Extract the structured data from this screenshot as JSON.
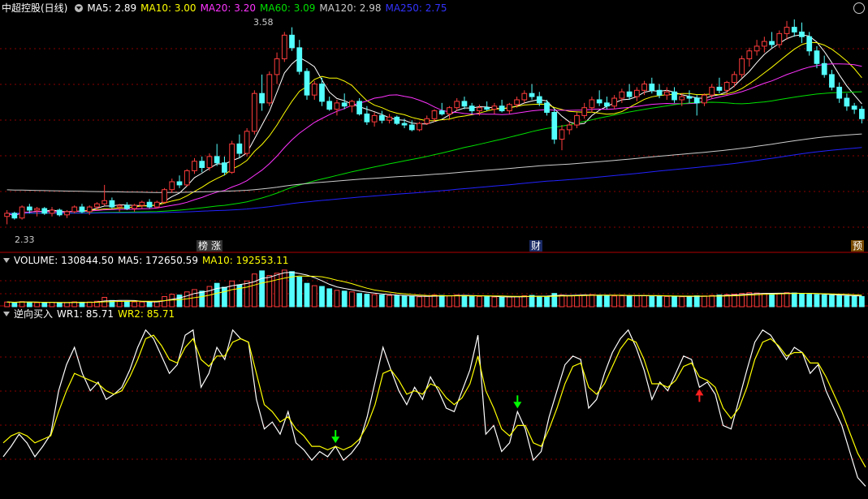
{
  "price_panel": {
    "title": "中超控股(日线)",
    "ma5": "MA5: 2.89",
    "ma10": "MA10: 3.00",
    "ma20": "MA20: 3.20",
    "ma60": "MA60: 3.09",
    "ma120": "MA120: 2.98",
    "ma250": "MA250: 2.75",
    "high_label": "3.58",
    "low_label": "2.33",
    "events": [
      "榜",
      "涨",
      "财",
      "预"
    ]
  },
  "volume_panel": {
    "vol": "VOLUME: 130844.50",
    "ma5": "MA5: 172650.59",
    "ma10": "MA10: 192553.11"
  },
  "indicator_panel": {
    "name": "逆向买入",
    "wr1": "WR1: 85.71",
    "wr2": "WR2: 85.71"
  },
  "colors": {
    "up": "#ff3c3c",
    "down": "#54ffff",
    "ma5": "#ffffff",
    "ma10": "#ffff00",
    "ma20": "#ff33ff",
    "ma60": "#00e000",
    "ma120": "#cccccc",
    "ma250": "#2222ff",
    "grid": "#8b0000"
  },
  "chart_data": {
    "type": "candlestick",
    "title": "中超控股(日线)",
    "price_range": [
      2.25,
      3.65
    ],
    "candles": [
      [
        2.38,
        2.42,
        2.33,
        2.4
      ],
      [
        2.4,
        2.41,
        2.36,
        2.37
      ],
      [
        2.37,
        2.45,
        2.36,
        2.44
      ],
      [
        2.44,
        2.46,
        2.4,
        2.42
      ],
      [
        2.42,
        2.44,
        2.38,
        2.43
      ],
      [
        2.43,
        2.44,
        2.39,
        2.4
      ],
      [
        2.4,
        2.44,
        2.38,
        2.42
      ],
      [
        2.42,
        2.43,
        2.38,
        2.39
      ],
      [
        2.39,
        2.42,
        2.37,
        2.41
      ],
      [
        2.41,
        2.45,
        2.4,
        2.44
      ],
      [
        2.44,
        2.46,
        2.4,
        2.41
      ],
      [
        2.41,
        2.45,
        2.39,
        2.44
      ],
      [
        2.44,
        2.47,
        2.42,
        2.46
      ],
      [
        2.46,
        2.58,
        2.45,
        2.48
      ],
      [
        2.48,
        2.5,
        2.43,
        2.44
      ],
      [
        2.44,
        2.46,
        2.41,
        2.45
      ],
      [
        2.45,
        2.47,
        2.42,
        2.43
      ],
      [
        2.43,
        2.46,
        2.41,
        2.45
      ],
      [
        2.45,
        2.48,
        2.43,
        2.47
      ],
      [
        2.47,
        2.49,
        2.43,
        2.44
      ],
      [
        2.44,
        2.48,
        2.43,
        2.47
      ],
      [
        2.47,
        2.56,
        2.46,
        2.55
      ],
      [
        2.55,
        2.62,
        2.53,
        2.6
      ],
      [
        2.6,
        2.64,
        2.56,
        2.58
      ],
      [
        2.58,
        2.68,
        2.57,
        2.67
      ],
      [
        2.67,
        2.75,
        2.65,
        2.73
      ],
      [
        2.73,
        2.76,
        2.66,
        2.69
      ],
      [
        2.69,
        2.78,
        2.67,
        2.76
      ],
      [
        2.76,
        2.84,
        2.7,
        2.72
      ],
      [
        2.72,
        2.76,
        2.64,
        2.66
      ],
      [
        2.66,
        2.86,
        2.65,
        2.84
      ],
      [
        2.84,
        2.9,
        2.75,
        2.78
      ],
      [
        2.78,
        2.94,
        2.76,
        2.92
      ],
      [
        2.92,
        3.18,
        2.9,
        3.16
      ],
      [
        3.16,
        3.28,
        3.05,
        3.1
      ],
      [
        3.1,
        3.3,
        3.08,
        3.28
      ],
      [
        3.28,
        3.42,
        3.22,
        3.38
      ],
      [
        3.38,
        3.55,
        3.36,
        3.53
      ],
      [
        3.53,
        3.58,
        3.43,
        3.45
      ],
      [
        3.45,
        3.5,
        3.28,
        3.3
      ],
      [
        3.3,
        3.32,
        3.12,
        3.15
      ],
      [
        3.15,
        3.24,
        3.12,
        3.22
      ],
      [
        3.22,
        3.26,
        3.08,
        3.11
      ],
      [
        3.11,
        3.14,
        3.05,
        3.06
      ],
      [
        3.06,
        3.12,
        3.02,
        3.1
      ],
      [
        3.1,
        3.16,
        3.06,
        3.08
      ],
      [
        3.08,
        3.12,
        3.04,
        3.11
      ],
      [
        3.11,
        3.13,
        3.02,
        3.03
      ],
      [
        3.03,
        3.08,
        2.96,
        2.98
      ],
      [
        2.98,
        3.04,
        2.95,
        3.02
      ],
      [
        3.02,
        3.05,
        2.97,
        2.99
      ],
      [
        2.99,
        3.03,
        2.97,
        3.01
      ],
      [
        3.01,
        3.02,
        2.96,
        2.97
      ],
      [
        2.97,
        3.0,
        2.94,
        2.96
      ],
      [
        2.96,
        2.99,
        2.92,
        2.93
      ],
      [
        2.93,
        2.98,
        2.92,
        2.97
      ],
      [
        2.97,
        3.02,
        2.96,
        3.0
      ],
      [
        3.0,
        3.06,
        2.98,
        3.05
      ],
      [
        3.05,
        3.1,
        3.02,
        3.03
      ],
      [
        3.03,
        3.08,
        3.0,
        3.07
      ],
      [
        3.07,
        3.13,
        3.05,
        3.11
      ],
      [
        3.11,
        3.14,
        3.06,
        3.08
      ],
      [
        3.08,
        3.1,
        3.03,
        3.05
      ],
      [
        3.05,
        3.09,
        3.02,
        3.07
      ],
      [
        3.07,
        3.11,
        3.05,
        3.06
      ],
      [
        3.06,
        3.1,
        3.03,
        3.08
      ],
      [
        3.08,
        3.12,
        3.04,
        3.05
      ],
      [
        3.05,
        3.1,
        3.03,
        3.09
      ],
      [
        3.09,
        3.14,
        3.07,
        3.12
      ],
      [
        3.12,
        3.18,
        3.1,
        3.16
      ],
      [
        3.16,
        3.22,
        3.12,
        3.14
      ],
      [
        3.14,
        3.17,
        3.08,
        3.1
      ],
      [
        3.1,
        3.12,
        3.02,
        3.04
      ],
      [
        3.04,
        3.06,
        2.84,
        2.87
      ],
      [
        2.87,
        2.96,
        2.8,
        2.93
      ],
      [
        2.93,
        2.98,
        2.9,
        2.96
      ],
      [
        2.96,
        3.04,
        2.94,
        3.02
      ],
      [
        3.02,
        3.1,
        3.0,
        3.07
      ],
      [
        3.07,
        3.14,
        3.04,
        3.12
      ],
      [
        3.12,
        3.18,
        3.08,
        3.1
      ],
      [
        3.1,
        3.14,
        3.06,
        3.08
      ],
      [
        3.08,
        3.15,
        3.06,
        3.13
      ],
      [
        3.13,
        3.19,
        3.1,
        3.17
      ],
      [
        3.17,
        3.22,
        3.12,
        3.14
      ],
      [
        3.14,
        3.2,
        3.11,
        3.18
      ],
      [
        3.18,
        3.24,
        3.15,
        3.22
      ],
      [
        3.22,
        3.26,
        3.16,
        3.18
      ],
      [
        3.18,
        3.22,
        3.13,
        3.15
      ],
      [
        3.15,
        3.2,
        3.12,
        3.17
      ],
      [
        3.17,
        3.2,
        3.1,
        3.12
      ],
      [
        3.12,
        3.16,
        3.08,
        3.14
      ],
      [
        3.14,
        3.18,
        3.1,
        3.13
      ],
      [
        3.13,
        3.15,
        3.02,
        3.1
      ],
      [
        3.1,
        3.16,
        3.08,
        3.15
      ],
      [
        3.15,
        3.22,
        3.13,
        3.2
      ],
      [
        3.2,
        3.26,
        3.16,
        3.18
      ],
      [
        3.18,
        3.24,
        3.15,
        3.23
      ],
      [
        3.23,
        3.3,
        3.2,
        3.28
      ],
      [
        3.28,
        3.4,
        3.26,
        3.38
      ],
      [
        3.38,
        3.45,
        3.33,
        3.43
      ],
      [
        3.43,
        3.5,
        3.4,
        3.46
      ],
      [
        3.46,
        3.52,
        3.42,
        3.49
      ],
      [
        3.49,
        3.55,
        3.45,
        3.47
      ],
      [
        3.47,
        3.56,
        3.45,
        3.54
      ],
      [
        3.54,
        3.62,
        3.5,
        3.58
      ],
      [
        3.58,
        3.63,
        3.52,
        3.55
      ],
      [
        3.55,
        3.61,
        3.48,
        3.52
      ],
      [
        3.52,
        3.55,
        3.4,
        3.43
      ],
      [
        3.43,
        3.46,
        3.32,
        3.35
      ],
      [
        3.35,
        3.4,
        3.26,
        3.28
      ],
      [
        3.28,
        3.31,
        3.18,
        3.2
      ],
      [
        3.2,
        3.23,
        3.1,
        3.13
      ],
      [
        3.13,
        3.16,
        3.05,
        3.08
      ],
      [
        3.08,
        3.1,
        3.03,
        3.06
      ],
      [
        3.06,
        3.08,
        2.97,
        3.0
      ]
    ],
    "volume_range": [
      0,
      500000
    ],
    "volumes": [
      60000,
      55000,
      65000,
      58000,
      52000,
      50000,
      56000,
      48000,
      54000,
      62000,
      58000,
      60000,
      70000,
      120000,
      80000,
      70000,
      65000,
      62000,
      60000,
      58000,
      64000,
      130000,
      160000,
      150000,
      190000,
      220000,
      200000,
      260000,
      300000,
      250000,
      330000,
      280000,
      330000,
      420000,
      460000,
      400000,
      430000,
      470000,
      450000,
      380000,
      300000,
      270000,
      260000,
      230000,
      210000,
      200000,
      190000,
      170000,
      160000,
      155000,
      150000,
      145000,
      140000,
      135000,
      130000,
      128000,
      135000,
      150000,
      145000,
      140000,
      150000,
      145000,
      138000,
      132000,
      128000,
      125000,
      120000,
      125000,
      130000,
      140000,
      145000,
      135000,
      130000,
      170000,
      150000,
      140000,
      145000,
      150000,
      155000,
      148000,
      142000,
      138000,
      140000,
      145000,
      140000,
      142000,
      138000,
      135000,
      132000,
      130000,
      128000,
      132000,
      140000,
      138000,
      145000,
      150000,
      155000,
      160000,
      170000,
      180000,
      175000,
      170000,
      165000,
      172000,
      180000,
      176000,
      168000,
      160000,
      155000,
      150000,
      146000,
      140000,
      136000,
      132000,
      130844
    ],
    "wr1": [
      22,
      28,
      35,
      30,
      22,
      28,
      35,
      60,
      75,
      85,
      70,
      60,
      65,
      55,
      58,
      62,
      72,
      85,
      95,
      90,
      80,
      70,
      75,
      92,
      95,
      62,
      70,
      85,
      78,
      95,
      90,
      88,
      55,
      38,
      42,
      35,
      48,
      30,
      26,
      20,
      25,
      22,
      28,
      20,
      24,
      30,
      45,
      65,
      85,
      72,
      60,
      52,
      62,
      55,
      68,
      60,
      50,
      48,
      60,
      72,
      92,
      35,
      40,
      25,
      30,
      48,
      38,
      20,
      25,
      45,
      60,
      75,
      80,
      78,
      50,
      55,
      70,
      82,
      90,
      95,
      85,
      72,
      55,
      65,
      60,
      70,
      80,
      78,
      62,
      65,
      58,
      40,
      38,
      55,
      72,
      88,
      95,
      92,
      85,
      78,
      85,
      82,
      70,
      75,
      60,
      50,
      40,
      25,
      10,
      5
    ],
    "wr2": [
      30,
      34,
      36,
      34,
      30,
      32,
      34,
      48,
      60,
      70,
      68,
      66,
      64,
      60,
      58,
      60,
      68,
      78,
      90,
      92,
      86,
      78,
      76,
      85,
      90,
      78,
      74,
      80,
      80,
      88,
      90,
      88,
      70,
      52,
      48,
      42,
      45,
      38,
      34,
      28,
      28,
      26,
      28,
      26,
      28,
      32,
      40,
      52,
      70,
      72,
      66,
      58,
      60,
      58,
      64,
      62,
      56,
      52,
      56,
      64,
      80,
      60,
      50,
      38,
      34,
      40,
      40,
      30,
      28,
      38,
      50,
      64,
      74,
      76,
      62,
      58,
      64,
      74,
      84,
      90,
      88,
      78,
      64,
      64,
      62,
      66,
      74,
      76,
      68,
      66,
      62,
      50,
      44,
      50,
      62,
      78,
      88,
      90,
      86,
      80,
      82,
      82,
      76,
      76,
      68,
      58,
      48,
      36,
      24,
      16
    ],
    "signals_up": [
      42,
      65
    ],
    "signals_down": [
      88
    ]
  }
}
